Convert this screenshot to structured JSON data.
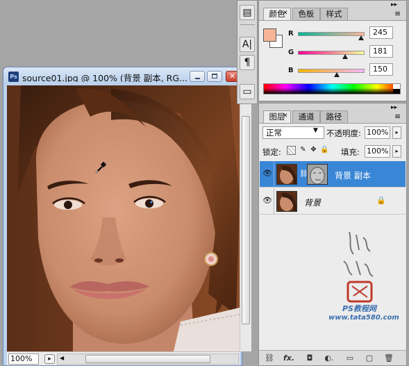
{
  "document": {
    "title": "source01.jpg @ 100% (背景 副本, RG...",
    "app_icon": "Ps",
    "zoom": "100%",
    "status_nav_icon": "▸"
  },
  "tools": {
    "icons": [
      "clone-source-icon",
      "type-tool-icon",
      "paragraph-icon",
      "notes-icon"
    ],
    "glyphs": [
      "▤",
      "A|",
      "¶",
      "▭"
    ]
  },
  "color_panel": {
    "tabs": [
      "颜色",
      "色板",
      "样式"
    ],
    "fg_color": "#f5b596",
    "channels": [
      {
        "label": "R",
        "value": "245",
        "fraction": 0.96,
        "gradient": "linear-gradient(90deg,#00b596,#ffb596)"
      },
      {
        "label": "G",
        "value": "181",
        "fraction": 0.71,
        "gradient": "linear-gradient(90deg,#f50096,#f5ff96)"
      },
      {
        "label": "B",
        "value": "150",
        "fraction": 0.59,
        "gradient": "linear-gradient(90deg,#f5b500,#f5b5ff)"
      }
    ]
  },
  "layers_panel": {
    "tabs": [
      "图层",
      "通道",
      "路径"
    ],
    "blend_mode": "正常",
    "opacity_label": "不透明度:",
    "opacity": "100%",
    "lock_label": "锁定:",
    "fill_label": "填充:",
    "fill": "100%",
    "layers": [
      {
        "name": "背景 副本",
        "selected": true,
        "has_mask": true
      },
      {
        "name": "背景",
        "selected": false,
        "locked": true
      }
    ],
    "footer_icons": [
      "link-layers-icon",
      "fx-icon",
      "add-mask-icon",
      "adjustment-layer-icon",
      "new-group-icon",
      "new-layer-icon",
      "delete-layer-icon"
    ],
    "footer_glyphs": [
      "⛓",
      "fx.",
      "◘",
      "◐.",
      "▭",
      "▢",
      "🗑"
    ]
  },
  "watermark": {
    "site_name": "PS教程网",
    "url": "www.tata580.com"
  },
  "colors": {
    "selection_blue": "#3a86d6",
    "panel_gray": "#d4d4d4",
    "skin": "#c98c6c"
  }
}
